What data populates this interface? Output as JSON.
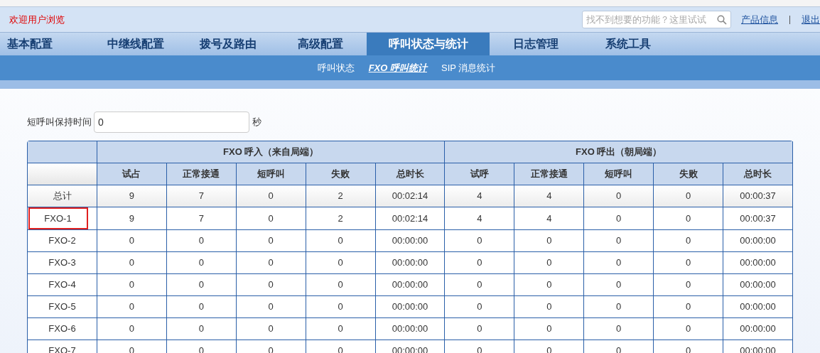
{
  "header": {
    "welcome": "欢迎用户浏览",
    "search": {
      "placeholder": "找不到想要的功能？这里试试"
    },
    "links": [
      "产品信息",
      "退出"
    ]
  },
  "tabs": [
    {
      "label": "基本配置",
      "selected": false
    },
    {
      "label": "中继线配置",
      "selected": false
    },
    {
      "label": "拨号及路由",
      "selected": false
    },
    {
      "label": "高级配置",
      "selected": false
    },
    {
      "label": "呼叫状态与统计",
      "selected": true
    },
    {
      "label": "日志管理",
      "selected": false
    },
    {
      "label": "系统工具",
      "selected": false
    }
  ],
  "subtabs": [
    {
      "label": "呼叫状态",
      "selected": false
    },
    {
      "label": "FXO 呼叫统计",
      "selected": true
    },
    {
      "label": "SIP 消息统计",
      "selected": false
    }
  ],
  "hold_time": {
    "label": "短呼叫保持时间",
    "value": "0",
    "unit": "秒"
  },
  "table": {
    "groups": [
      "FXO 呼入（来自局端）",
      "FXO 呼出（朝局端）"
    ],
    "columns": [
      "试占",
      "正常接通",
      "短呼叫",
      "失败",
      "总时长",
      "试呼",
      "正常接通",
      "短呼叫",
      "失败",
      "总时长"
    ],
    "rows": [
      {
        "kind": "total",
        "label": "总计",
        "highlighted": false,
        "cells": [
          "9",
          "7",
          "0",
          "2",
          "00:02:14",
          "4",
          "4",
          "0",
          "0",
          "00:00:37"
        ]
      },
      {
        "kind": "port",
        "label": "FXO-1",
        "highlighted": true,
        "cells": [
          "9",
          "7",
          "0",
          "2",
          "00:02:14",
          "4",
          "4",
          "0",
          "0",
          "00:00:37"
        ]
      },
      {
        "kind": "port",
        "label": "FXO-2",
        "highlighted": false,
        "cells": [
          "0",
          "0",
          "0",
          "0",
          "00:00:00",
          "0",
          "0",
          "0",
          "0",
          "00:00:00"
        ]
      },
      {
        "kind": "port",
        "label": "FXO-3",
        "highlighted": false,
        "cells": [
          "0",
          "0",
          "0",
          "0",
          "00:00:00",
          "0",
          "0",
          "0",
          "0",
          "00:00:00"
        ]
      },
      {
        "kind": "port",
        "label": "FXO-4",
        "highlighted": false,
        "cells": [
          "0",
          "0",
          "0",
          "0",
          "00:00:00",
          "0",
          "0",
          "0",
          "0",
          "00:00:00"
        ]
      },
      {
        "kind": "port",
        "label": "FXO-5",
        "highlighted": false,
        "cells": [
          "0",
          "0",
          "0",
          "0",
          "00:00:00",
          "0",
          "0",
          "0",
          "0",
          "00:00:00"
        ]
      },
      {
        "kind": "port",
        "label": "FXO-6",
        "highlighted": false,
        "cells": [
          "0",
          "0",
          "0",
          "0",
          "00:00:00",
          "0",
          "0",
          "0",
          "0",
          "00:00:00"
        ]
      },
      {
        "kind": "port",
        "label": "FXO-7",
        "highlighted": false,
        "cells": [
          "0",
          "0",
          "0",
          "0",
          "00:00:00",
          "0",
          "0",
          "0",
          "0",
          "00:00:00"
        ]
      }
    ]
  }
}
